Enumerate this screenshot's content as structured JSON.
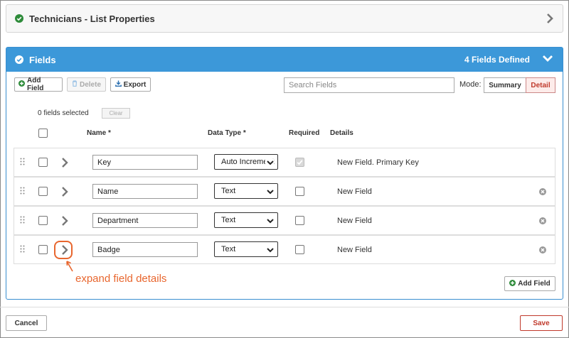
{
  "list_properties": {
    "title": "Technicians - List Properties"
  },
  "fields_panel": {
    "title": "Fields",
    "count_label": "4 Fields Defined",
    "toolbar": {
      "add_field": "Add Field",
      "delete": "Delete",
      "export": "Export",
      "search_placeholder": "Search Fields",
      "mode_label": "Mode:",
      "mode_summary": "Summary",
      "mode_detail": "Detail",
      "selected_mode": "Detail"
    },
    "selection": {
      "text": "0 fields selected",
      "clear": "Clear"
    },
    "columns": {
      "name": "Name *",
      "data_type": "Data Type *",
      "required": "Required",
      "details": "Details"
    },
    "rows": [
      {
        "name": "Key",
        "data_type": "Auto Increment",
        "required": true,
        "required_disabled": true,
        "details": "New Field. Primary Key",
        "removable": false
      },
      {
        "name": "Name",
        "data_type": "Text",
        "required": false,
        "details": "New Field",
        "removable": true
      },
      {
        "name": "Department",
        "data_type": "Text",
        "required": false,
        "details": "New Field",
        "removable": true
      },
      {
        "name": "Badge",
        "data_type": "Text",
        "required": false,
        "details": "New Field",
        "removable": true
      }
    ],
    "callout": "expand field details",
    "add_field_bottom": "Add Field"
  },
  "footer": {
    "cancel": "Cancel",
    "save": "Save"
  },
  "colors": {
    "accent": "#3c98d9",
    "success": "#2e8b3a",
    "danger": "#c0392b",
    "callout": "#e8662e"
  }
}
